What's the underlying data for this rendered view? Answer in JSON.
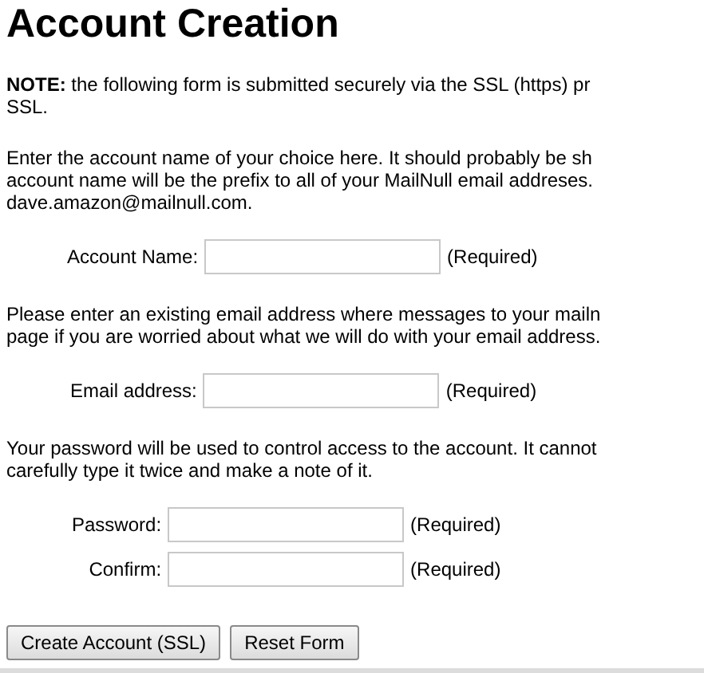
{
  "title": "Account Creation",
  "sections": [
    {
      "kind": "paragraph",
      "lines": [
        "**NOTE:** the following form is submitted securely via the SSL (https) pr",
        "SSL."
      ]
    },
    {
      "kind": "paragraph",
      "lines": [
        "Enter the account name of your choice here. It should probably be sh",
        "account name will be the prefix to all of your MailNull email addreses.",
        "dave.amazon@mailnull.com."
      ]
    },
    {
      "kind": "fields",
      "fields": [
        {
          "label": "Account Name:",
          "note": "(Required)"
        }
      ]
    },
    {
      "kind": "paragraph",
      "lines": [
        "Please enter an existing email address where messages to your mailn",
        "page if you are worried about what we will do with your email address."
      ]
    },
    {
      "kind": "fields",
      "fields": [
        {
          "label": "Email address:",
          "note": "(Required)"
        }
      ]
    },
    {
      "kind": "paragraph",
      "lines": [
        "Your password will be used to control access to the account. It cannot",
        "carefully type it twice and make a note of it."
      ]
    },
    {
      "kind": "fields",
      "fields": [
        {
          "label": "Password:",
          "note": "(Required)"
        },
        {
          "label": "Confirm:",
          "note": "(Required)"
        }
      ]
    }
  ],
  "buttons": [
    "Create Account (SSL)",
    "Reset Form"
  ]
}
